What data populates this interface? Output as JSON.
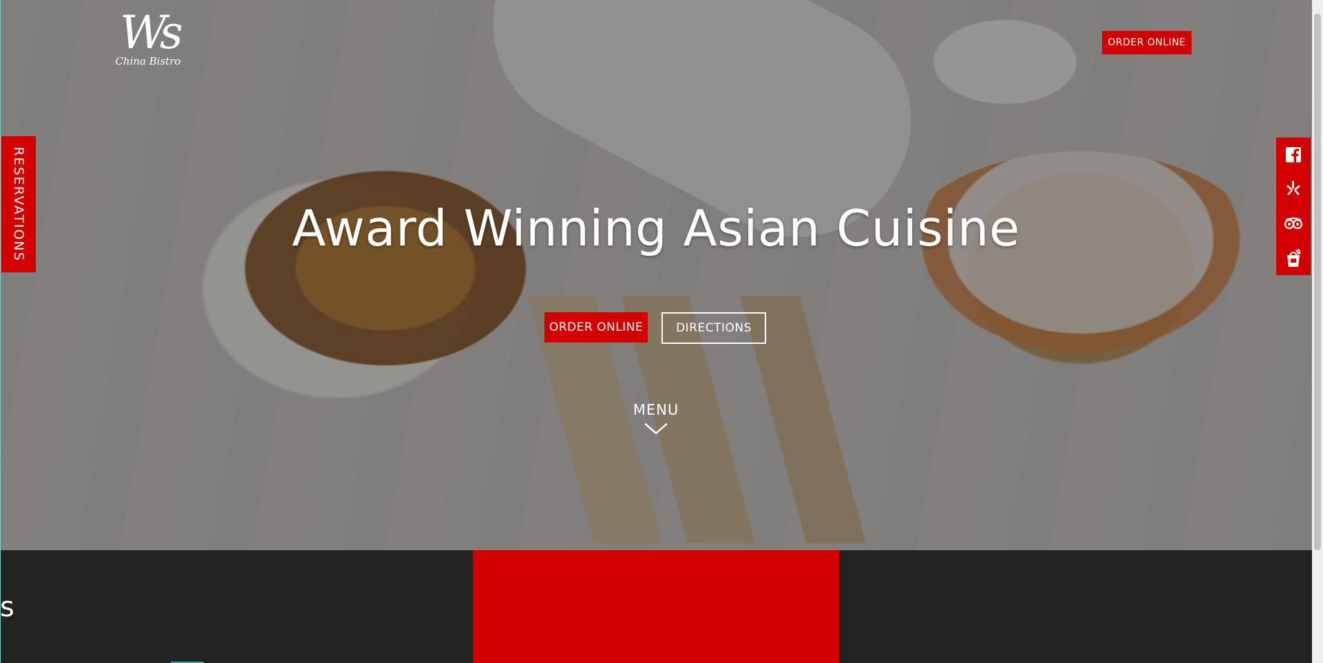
{
  "brand": {
    "logo_mark": "Ws",
    "logo_sub": "China Bistro"
  },
  "header": {
    "order_online_label": "ORDER ONLINE"
  },
  "reservations": {
    "label": "RESERVATIONS"
  },
  "hero": {
    "headline": "Award Winning Asian Cuisine",
    "order_online_label": "ORDER ONLINE",
    "directions_label": "DIRECTIONS",
    "menu_label": "MENU"
  },
  "social": [
    {
      "name": "facebook-icon"
    },
    {
      "name": "yelp-icon"
    },
    {
      "name": "tripadvisor-icon"
    },
    {
      "name": "takeout-box-icon"
    }
  ],
  "colors": {
    "accent_red": "#d30000",
    "dark_band": "#232323",
    "text_white": "#ffffff"
  }
}
